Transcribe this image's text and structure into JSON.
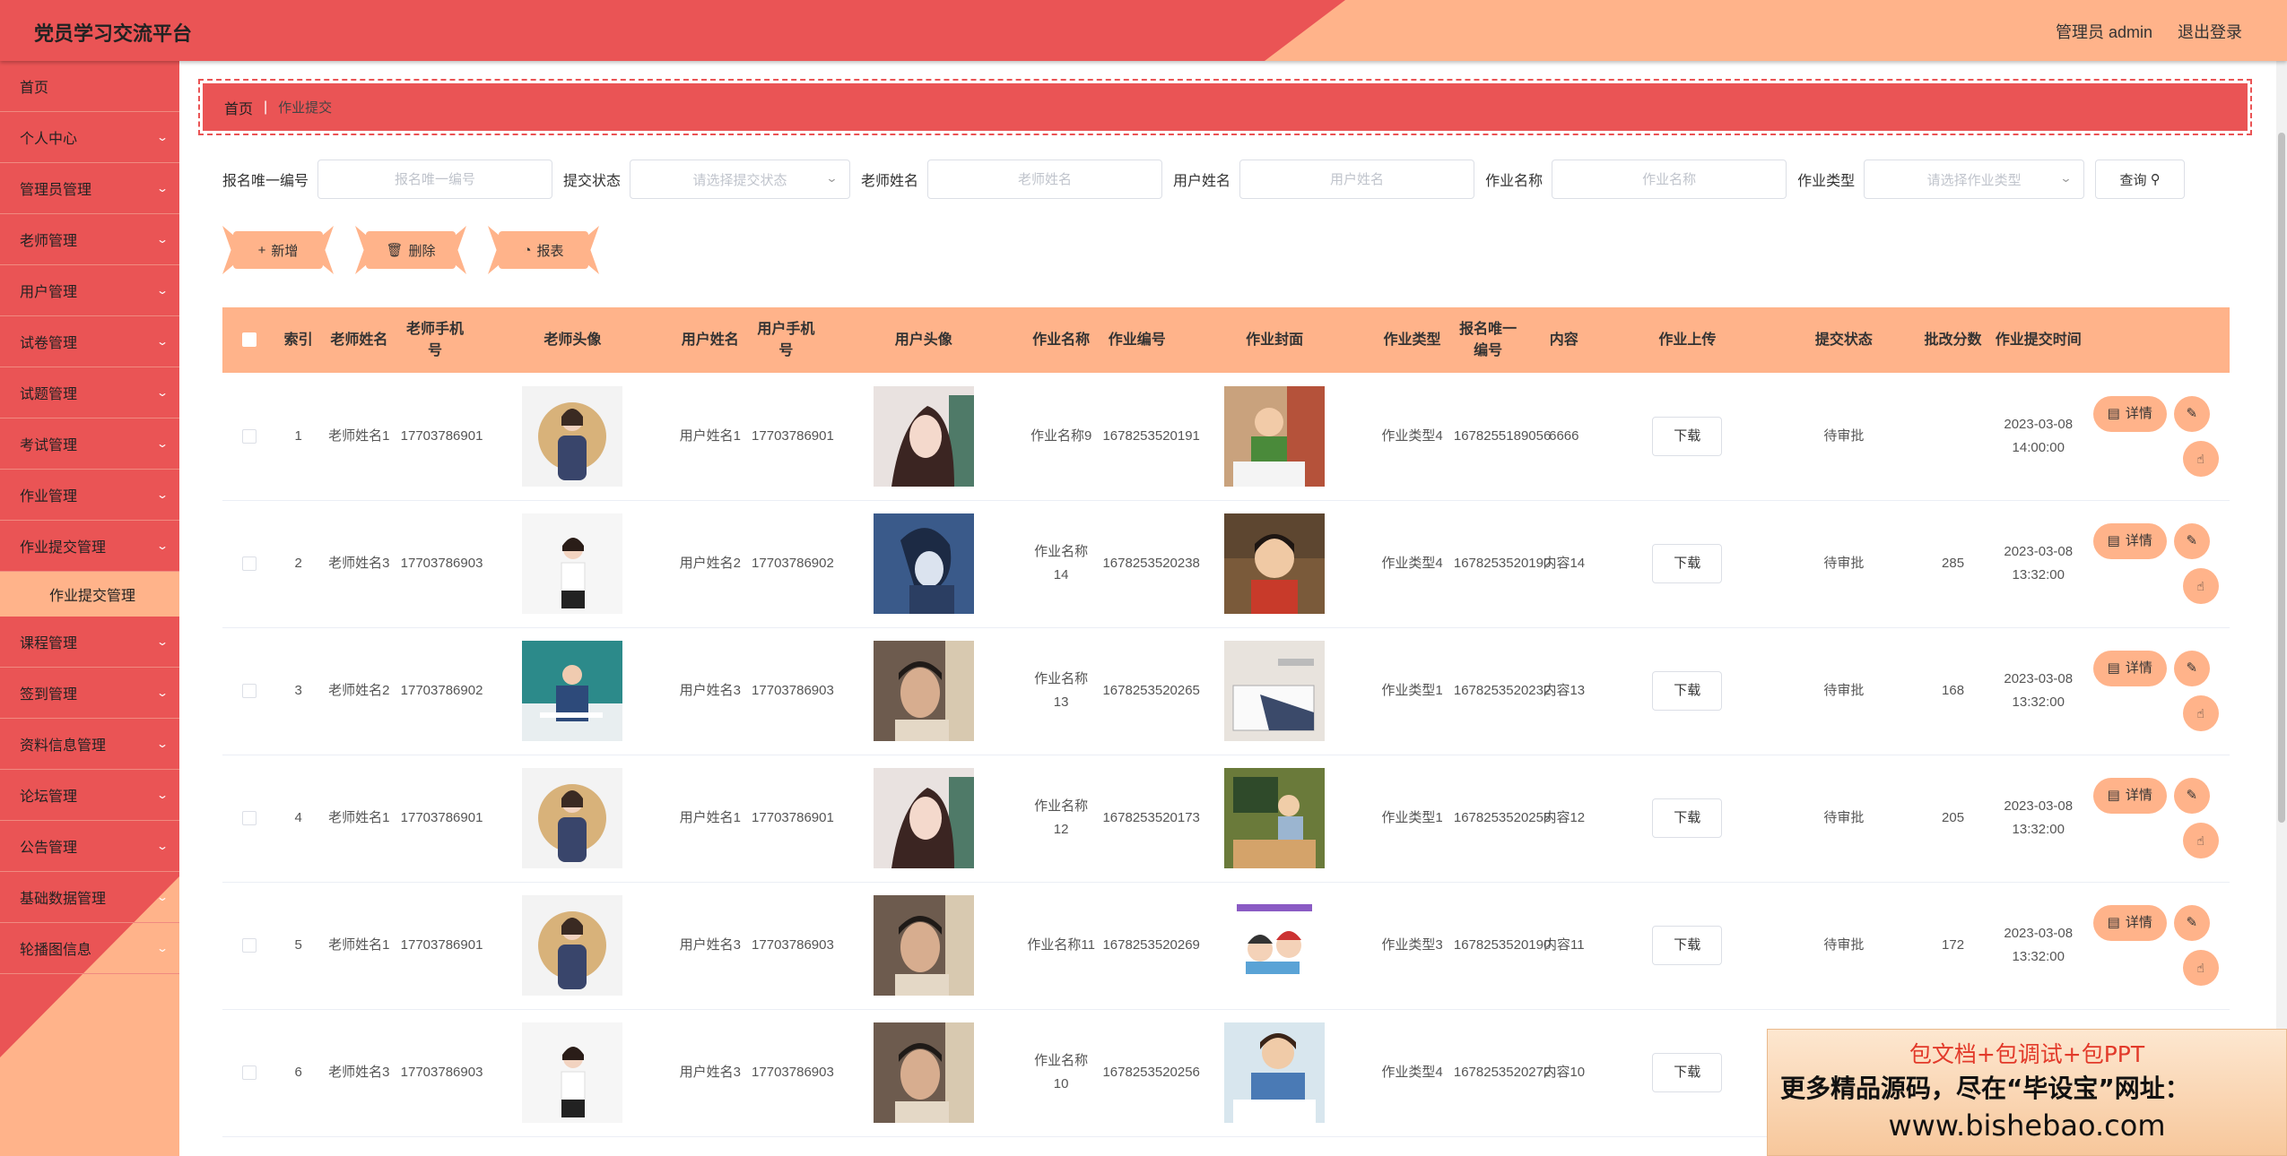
{
  "header": {
    "title": "党员学习交流平台",
    "user": "管理员 admin",
    "logout": "退出登录"
  },
  "sidebar": {
    "items": [
      {
        "label": "首页",
        "chevron": false
      },
      {
        "label": "个人中心",
        "chevron": true
      },
      {
        "label": "管理员管理",
        "chevron": true
      },
      {
        "label": "老师管理",
        "chevron": true
      },
      {
        "label": "用户管理",
        "chevron": true
      },
      {
        "label": "试卷管理",
        "chevron": true
      },
      {
        "label": "试题管理",
        "chevron": true
      },
      {
        "label": "考试管理",
        "chevron": true
      },
      {
        "label": "作业管理",
        "chevron": true
      },
      {
        "label": "作业提交管理",
        "chevron": true
      }
    ],
    "active_sub": "作业提交管理",
    "items_after": [
      {
        "label": "课程管理"
      },
      {
        "label": "签到管理"
      },
      {
        "label": "资料信息管理"
      },
      {
        "label": "论坛管理"
      },
      {
        "label": "公告管理"
      },
      {
        "label": "基础数据管理"
      },
      {
        "label": "轮播图信息"
      }
    ]
  },
  "breadcrumb": {
    "home": "首页",
    "current": "作业提交"
  },
  "search": {
    "f1_label": "报名唯一编号",
    "f1_placeholder": "报名唯一编号",
    "f2_label": "提交状态",
    "f2_placeholder": "请选择提交状态",
    "f3_label": "老师姓名",
    "f3_placeholder": "老师姓名",
    "f4_label": "用户姓名",
    "f4_placeholder": "用户姓名",
    "f5_label": "作业名称",
    "f5_placeholder": "作业名称",
    "f6_label": "作业类型",
    "f6_placeholder": "请选择作业类型",
    "query": "查询"
  },
  "actions": {
    "add": "新增",
    "delete": "删除",
    "report": "报表"
  },
  "table": {
    "headers": {
      "index": "索引",
      "teacher_name": "老师姓名",
      "teacher_phone": "老师手机号",
      "teacher_avatar": "老师头像",
      "user_name": "用户姓名",
      "user_phone": "用户手机号",
      "user_avatar": "用户头像",
      "hw_name": "作业名称",
      "hw_no": "作业编号",
      "hw_cover": "作业封面",
      "hw_type": "作业类型",
      "signup_no": "报名唯一编号",
      "content": "内容",
      "hw_upload": "作业上传",
      "status": "提交状态",
      "score": "批改分数",
      "submit_time": "作业提交时间"
    },
    "download_label": "下载",
    "detail_label": "详情",
    "rows": [
      {
        "index": "1",
        "teacher": "老师姓名1",
        "tphone": "17703786901",
        "user": "用户姓名1",
        "uphone": "17703786901",
        "hw": "作业名称9",
        "hwno": "1678253520191",
        "type": "作业类型4",
        "signup": "1678255189056",
        "content": "6666",
        "status": "待审批",
        "score": "",
        "time": "2023-03-08 14:00:00"
      },
      {
        "index": "2",
        "teacher": "老师姓名3",
        "tphone": "17703786903",
        "user": "用户姓名2",
        "uphone": "17703786902",
        "hw": "作业名称14",
        "hwno": "1678253520238",
        "type": "作业类型4",
        "signup": "1678253520190",
        "content": "内容14",
        "status": "待审批",
        "score": "285",
        "time": "2023-03-08 13:32:00"
      },
      {
        "index": "3",
        "teacher": "老师姓名2",
        "tphone": "17703786902",
        "user": "用户姓名3",
        "uphone": "17703786903",
        "hw": "作业名称13",
        "hwno": "1678253520265",
        "type": "作业类型1",
        "signup": "1678253520232",
        "content": "内容13",
        "status": "待审批",
        "score": "168",
        "time": "2023-03-08 13:32:00"
      },
      {
        "index": "4",
        "teacher": "老师姓名1",
        "tphone": "17703786901",
        "user": "用户姓名1",
        "uphone": "17703786901",
        "hw": "作业名称12",
        "hwno": "1678253520173",
        "type": "作业类型1",
        "signup": "1678253520258",
        "content": "内容12",
        "status": "待审批",
        "score": "205",
        "time": "2023-03-08 13:32:00"
      },
      {
        "index": "5",
        "teacher": "老师姓名1",
        "tphone": "17703786901",
        "user": "用户姓名3",
        "uphone": "17703786903",
        "hw": "作业名称11",
        "hwno": "1678253520269",
        "type": "作业类型3",
        "signup": "1678253520190",
        "content": "内容11",
        "status": "待审批",
        "score": "172",
        "time": "2023-03-08 13:32:00"
      },
      {
        "index": "6",
        "teacher": "老师姓名3",
        "tphone": "17703786903",
        "user": "用户姓名3",
        "uphone": "17703786903",
        "hw": "作业名称10",
        "hwno": "1678253520256",
        "type": "作业类型4",
        "signup": "1678253520272",
        "content": "内容10",
        "status": "",
        "score": "",
        "time": ""
      }
    ]
  },
  "promo": {
    "line1": "包文档+包调试+包PPT",
    "line2": "更多精品源码，尽在“毕设宝”网址：",
    "line3": "www.bishebao.com"
  },
  "colors": {
    "primary_red": "#ea5455",
    "accent_peach": "#ffb38a"
  }
}
